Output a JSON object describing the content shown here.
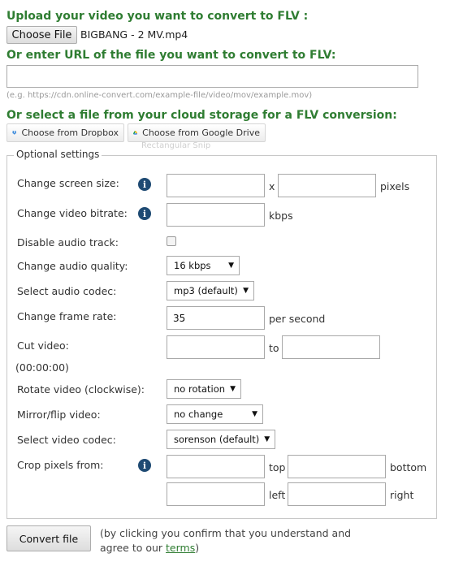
{
  "upload": {
    "heading": "Upload your video you want to convert to FLV :",
    "choose_file_label": "Choose File",
    "file_name": "BIGBANG - 2 MV.mp4"
  },
  "url": {
    "heading": "Or enter URL of the file you want to convert to FLV:",
    "value": "",
    "hint": "(e.g. https://cdn.online-convert.com/example-file/video/mov/example.mov)"
  },
  "cloud": {
    "heading": "Or select a file from your cloud storage for a FLV conversion:",
    "dropbox_label": "Choose from Dropbox",
    "google_drive_label": "Choose from Google Drive",
    "overlay_text": "Rectangular Snip"
  },
  "optional": {
    "legend": "Optional settings",
    "screen_size": {
      "label": "Change screen size:",
      "width": "",
      "height": "",
      "separator": "x",
      "unit": "pixels"
    },
    "video_bitrate": {
      "label": "Change video bitrate:",
      "value": "",
      "unit": "kbps"
    },
    "disable_audio": {
      "label": "Disable audio track:"
    },
    "audio_quality": {
      "label": "Change audio quality:",
      "selected": "16 kbps"
    },
    "audio_codec": {
      "label": "Select audio codec:",
      "selected": "mp3 (default)"
    },
    "frame_rate": {
      "label": "Change frame rate:",
      "value": "35",
      "unit": "per second"
    },
    "cut_video": {
      "label": "Cut video:",
      "hint": "(00:00:00)",
      "from": "",
      "separator": "to",
      "to": ""
    },
    "rotate": {
      "label": "Rotate video (clockwise):",
      "selected": "no rotation"
    },
    "mirror": {
      "label": "Mirror/flip video:",
      "selected": "no change"
    },
    "video_codec": {
      "label": "Select video codec:",
      "selected": "sorenson (default)"
    },
    "crop": {
      "label": "Crop pixels from:",
      "top_label": "top",
      "bottom_label": "bottom",
      "left_label": "left",
      "right_label": "right",
      "top": "",
      "bottom": "",
      "left": "",
      "right": ""
    }
  },
  "footer": {
    "convert_label": "Convert file",
    "note_line1": "(by clicking you confirm that you understand and",
    "note_line2_prefix": "agree to our ",
    "terms_link": "terms",
    "note_line2_suffix": ")"
  },
  "colors": {
    "heading_green": "#2f7d32",
    "info_icon": "#1e4a73"
  }
}
